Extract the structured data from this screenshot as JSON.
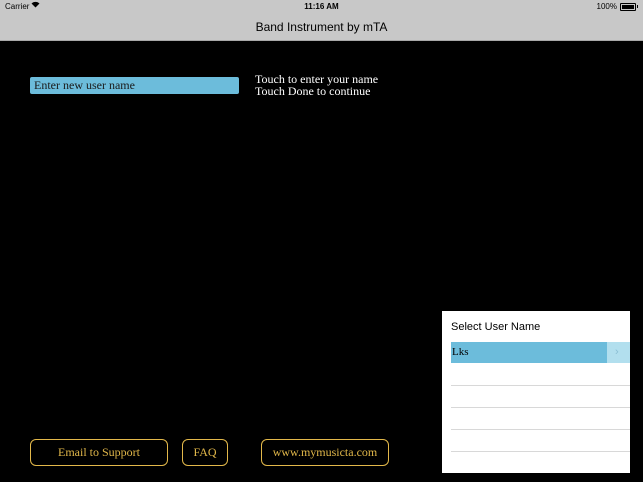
{
  "status_bar": {
    "carrier": "Carrier",
    "time": "11:16 AM",
    "battery": "100%"
  },
  "nav": {
    "title": "Band Instrument by mTA"
  },
  "form": {
    "name_placeholder": "Enter new user name"
  },
  "instructions": {
    "line1": "Touch to enter your name",
    "line2": "Touch Done to continue"
  },
  "buttons": {
    "email": "Email to Support",
    "faq": "FAQ",
    "website": "www.mymusicta.com"
  },
  "user_panel": {
    "header": "Select User Name",
    "users": [
      "Lks"
    ]
  },
  "colors": {
    "accent_blue": "#6cbcdb",
    "gold": "#e2b84a",
    "bar_gray": "#c8c8c8"
  }
}
